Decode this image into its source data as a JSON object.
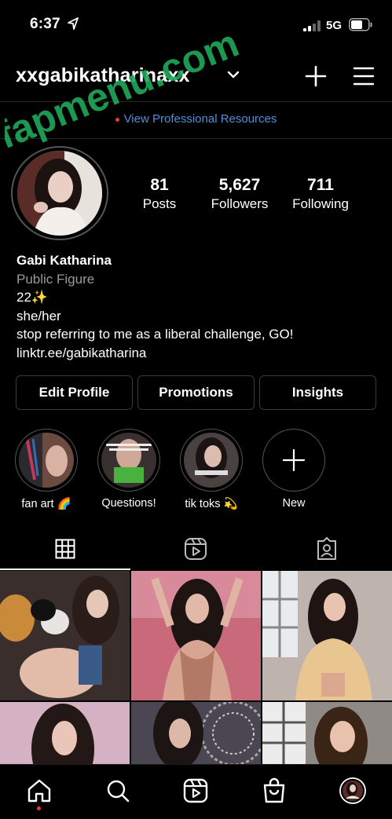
{
  "status_bar": {
    "time": "6:37",
    "network": "5G"
  },
  "header": {
    "username": "xxgabikatharinaxx"
  },
  "professional": {
    "label": "View Professional Resources"
  },
  "watermark": {
    "text": "fapmenu.com"
  },
  "stats": [
    {
      "value": "81",
      "label": "Posts"
    },
    {
      "value": "5,627",
      "label": "Followers"
    },
    {
      "value": "711",
      "label": "Following"
    }
  ],
  "bio": {
    "name": "Gabi Katharina",
    "category": "Public Figure",
    "line1": "22✨",
    "line2": "she/her",
    "line3": "stop referring to me as a liberal challenge, GO!",
    "link": "linktr.ee/gabikatharina"
  },
  "buttons": {
    "edit": "Edit Profile",
    "promotions": "Promotions",
    "insights": "Insights"
  },
  "highlights": [
    {
      "label": "fan art 🌈"
    },
    {
      "label": "Questions!"
    },
    {
      "label": "tik toks 💫"
    },
    {
      "label": "New"
    }
  ],
  "tabs": [
    "grid-icon",
    "reels-icon",
    "tagged-icon"
  ],
  "icons": [
    "location-arrow-icon",
    "signal-icon",
    "battery-icon",
    "chevron-down-icon",
    "plus-square-icon",
    "hamburger-menu-icon",
    "home-icon",
    "search-icon",
    "reels-icon",
    "shop-icon",
    "avatar"
  ],
  "colors": {
    "link": "#4f8fd9",
    "accent": "#ff3040",
    "watermark": "#1fa85a"
  }
}
